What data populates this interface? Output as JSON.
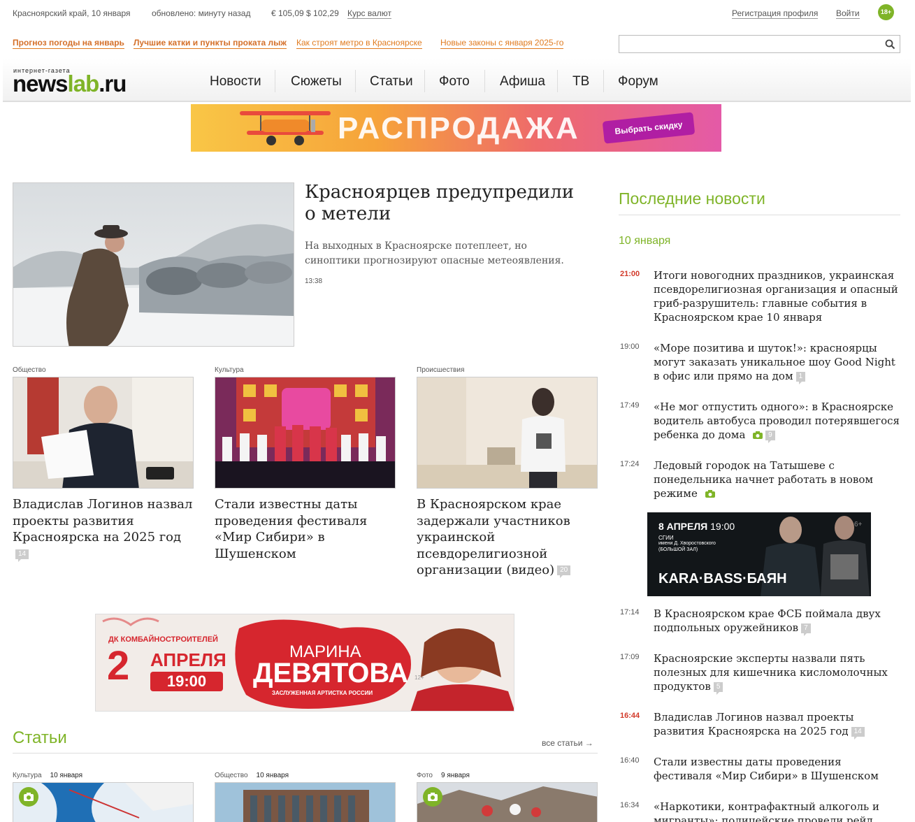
{
  "topbar": {
    "region": "Красноярский край, 10 января",
    "updated": "обновлено: минуту назад",
    "rates": "€ 105,09 $ 102,29",
    "rates_link": "Курс валют",
    "register": "Регистрация профиля",
    "login": "Войти",
    "age": "18+"
  },
  "hotlinks": [
    "Прогноз погоды на январь",
    "Лучшие катки и пункты проката лыж",
    "Как строят метро в Красноярске",
    "Новые законы с января 2025-го"
  ],
  "search": {
    "placeholder": "",
    "value": ""
  },
  "logo": {
    "tagline": "интернет-газета",
    "name_a": "news",
    "name_b": "lab",
    ".ru": ".ru",
    "suffix": ".ru"
  },
  "nav": [
    "Новости",
    "Сюжеты",
    "Статьи",
    "Фото",
    "Афиша",
    "ТВ",
    "Форум"
  ],
  "banner_top": {
    "word": "РАСПРОДАЖА",
    "button": "Выбрать скидку"
  },
  "lead": {
    "title": "Красноярцев предупредили о метели",
    "desc": "На выходных в Красноярске потеплеет, но синоптики прогнозируют опасные метеоявления.",
    "time": "13:38"
  },
  "cards": [
    {
      "cat": "Общество",
      "title": "Владислав Логинов назвал проекты развития Красноярска на 2025 год",
      "count": "14"
    },
    {
      "cat": "Культура",
      "title": "Стали известны даты проведения фестиваля «Мир Сибири» в Шушенском",
      "count": ""
    },
    {
      "cat": "Происшествия",
      "title": "В Красноярском крае задержали участников украинской псевдорелигиозной организации (видео)",
      "count": "20"
    }
  ],
  "banner_mid": {
    "venue": "ДК КОМБАЙНОСТРОИТЕЛЕЙ",
    "day": "2",
    "month": "АПРЕЛЯ",
    "time": "19:00",
    "name1": "МАРИНА",
    "name2": "ДЕВЯТОВА",
    "subtitle": "ЗАСЛУЖЕННАЯ АРТИСТКА РОССИИ",
    "age": "12+"
  },
  "articles": {
    "title": "Статьи",
    "all": "все статьи →",
    "items": [
      {
        "cat": "Культура",
        "date": "10 января"
      },
      {
        "cat": "Общество",
        "date": "10 января"
      },
      {
        "cat": "Фото",
        "date": "9 января"
      }
    ]
  },
  "sidebar": {
    "title": "Последние новости",
    "date": "10 января",
    "news": [
      {
        "time": "21:00",
        "red": true,
        "title": "Итоги новогодних праздников, украинская псевдорелигиозная организация и опасный гриб-разрушитель: главные события в Красноярском крае 10 января",
        "count": "",
        "photo": false
      },
      {
        "time": "19:00",
        "red": false,
        "title": "«Море позитива и шуток!»: красноярцы могут заказать уникальное шоу Good Night в офис или прямо на дом",
        "count": "1",
        "photo": false
      },
      {
        "time": "17:49",
        "red": false,
        "title": "«Не мог отпустить одного»: в Красноярске водитель автобуса проводил потерявшегося ребенка до дома",
        "count": "9",
        "photo": true
      },
      {
        "time": "17:24",
        "red": false,
        "title": "Ледовый городок на Татышеве с понедельника начнет работать в новом режиме",
        "count": "",
        "photo": true
      },
      {
        "time": "17:14",
        "red": false,
        "title": "В Красноярском крае ФСБ поймала двух подпольных оружейников",
        "count": "7",
        "photo": false
      },
      {
        "time": "17:09",
        "red": false,
        "title": "Красноярские эксперты назвали пять полезных для кишечника кисломолочных продуктов",
        "count": "5",
        "photo": false
      },
      {
        "time": "16:44",
        "red": true,
        "title": "Владислав Логинов назвал проекты развития Красноярска на 2025 год",
        "count": "14",
        "photo": false
      },
      {
        "time": "16:40",
        "red": false,
        "title": "Стали известны даты проведения фестиваля «Мир Сибири» в Шушенском",
        "count": "",
        "photo": false
      },
      {
        "time": "16:34",
        "red": false,
        "title": "«Наркотики, контрафактный алкоголь и мигранты»: полицейские провели рейд",
        "count": "",
        "photo": false
      }
    ]
  },
  "side_banner": {
    "date": "8 АПРЕЛЯ",
    "time": "19:00",
    "venue1": "СГИИ",
    "venue2": "имени Д. Хворостовского",
    "venue3": "(БОЛЬШОЙ ЗАЛ)",
    "title": "KARA·BASS·БАЯН",
    "age": "6+"
  }
}
